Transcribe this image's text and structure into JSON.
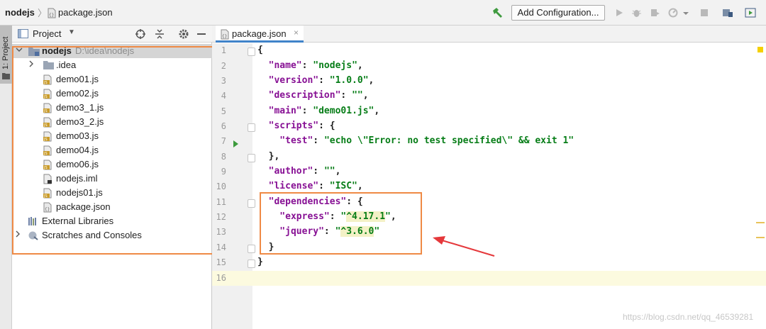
{
  "navbar": {
    "breadcrumb_root": "nodejs",
    "breadcrumb_separator": "〉",
    "breadcrumb_file": "package.json",
    "add_configuration_label": "Add Configuration..."
  },
  "tool_strip": {
    "project_tab_label": "1: Project"
  },
  "project_panel": {
    "title": "Project",
    "tree": [
      {
        "label": "nodejs",
        "path": "D:\\idea\\nodejs",
        "type": "module-folder",
        "expanded": true
      },
      {
        "label": ".idea",
        "type": "folder",
        "expanded": false
      },
      {
        "label": "demo01.js",
        "type": "js-file"
      },
      {
        "label": "demo02.js",
        "type": "js-file"
      },
      {
        "label": "demo3_1.js",
        "type": "js-file"
      },
      {
        "label": "demo3_2.js",
        "type": "js-file"
      },
      {
        "label": "demo03.js",
        "type": "js-file"
      },
      {
        "label": "demo04.js",
        "type": "js-file"
      },
      {
        "label": "demo06.js",
        "type": "js-file"
      },
      {
        "label": "nodejs.iml",
        "type": "iml-file"
      },
      {
        "label": "nodejs01.js",
        "type": "js-file"
      },
      {
        "label": "package.json",
        "type": "json-file"
      },
      {
        "label": "External Libraries",
        "type": "libraries"
      },
      {
        "label": "Scratches and Consoles",
        "type": "scratches",
        "expanded": false
      }
    ]
  },
  "editor": {
    "tab_label": "package.json",
    "tab_close": "×",
    "current_line": 16,
    "line_numbers": [
      "1",
      "2",
      "3",
      "4",
      "5",
      "6",
      "7",
      "8",
      "9",
      "10",
      "11",
      "12",
      "13",
      "14",
      "15",
      "16"
    ]
  },
  "watermark": "https://blog.csdn.net/qq_46539281",
  "colors": {
    "annotation": "#ef8a45",
    "arrow": "#e5383b",
    "json_key": "#871094",
    "json_string": "#067d17",
    "run_icon": "#3c9a3c"
  }
}
